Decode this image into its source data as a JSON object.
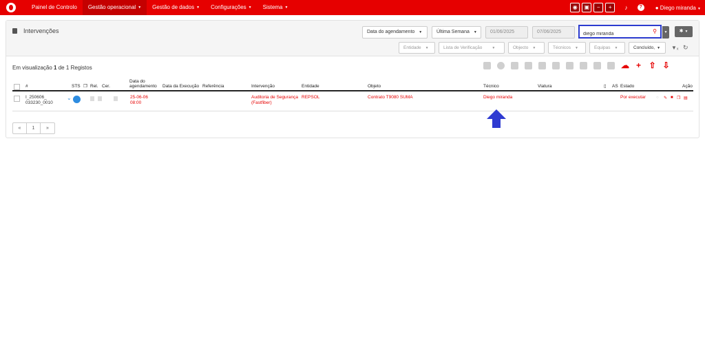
{
  "nav": {
    "items": [
      {
        "label": "Painel de Controlo",
        "active": false,
        "caret": false
      },
      {
        "label": "Gestão operacional",
        "active": true,
        "caret": true
      },
      {
        "label": "Gestão de dados",
        "active": false,
        "caret": true
      },
      {
        "label": "Configurações",
        "active": false,
        "caret": true
      },
      {
        "label": "Sistema",
        "active": false,
        "caret": true
      }
    ],
    "user": "Diego miranda",
    "help": "?"
  },
  "page": {
    "title": "Intervenções",
    "date_field": "Data do agendamento",
    "period": "Última Semana",
    "date_from": "01/06/2025",
    "date_to": "07/06/2025",
    "search_value": "diego miranda",
    "filters": {
      "entidade": "Entidade",
      "lista": "Lista de Verificação",
      "objecto": "Objecto",
      "tecnicos": "Técnicos",
      "equipas": "Equipas",
      "estado": "Concluído,"
    },
    "records": {
      "prefix": "Em visualização",
      "shown": "1",
      "mid": "de",
      "total": "1",
      "suffix": "Registos"
    }
  },
  "table": {
    "headers": {
      "num": "#",
      "sts": "STS",
      "rel": "Rel.",
      "cer": "Cer.",
      "data_ag": "Data do agendamento",
      "data_exec": "Data da Execução",
      "referencia": "Referência",
      "intervencao": "Intervenção",
      "entidade": "Entidade",
      "objeto": "Objeto",
      "tecnico": "Técnico",
      "viatura": "Viatura",
      "as": "AS",
      "estado": "Estado",
      "acao": "Ação"
    },
    "rows": [
      {
        "num": "I_250606_ 033230_0010",
        "data_ag": "25-06-06 08:00",
        "intervencao": "Auditoria de Segurança (Fastfiber)",
        "entidade": "REPSOL",
        "objeto": "Contrato T9080 SUMA",
        "tecnico": "Diego miranda",
        "estado": "Por executar"
      }
    ]
  },
  "pager": {
    "first": "«",
    "page": "1",
    "last": "»"
  },
  "colors": {
    "brand": "#e60000",
    "highlight": "#2b3bcf",
    "status": "#2d8ce0"
  }
}
